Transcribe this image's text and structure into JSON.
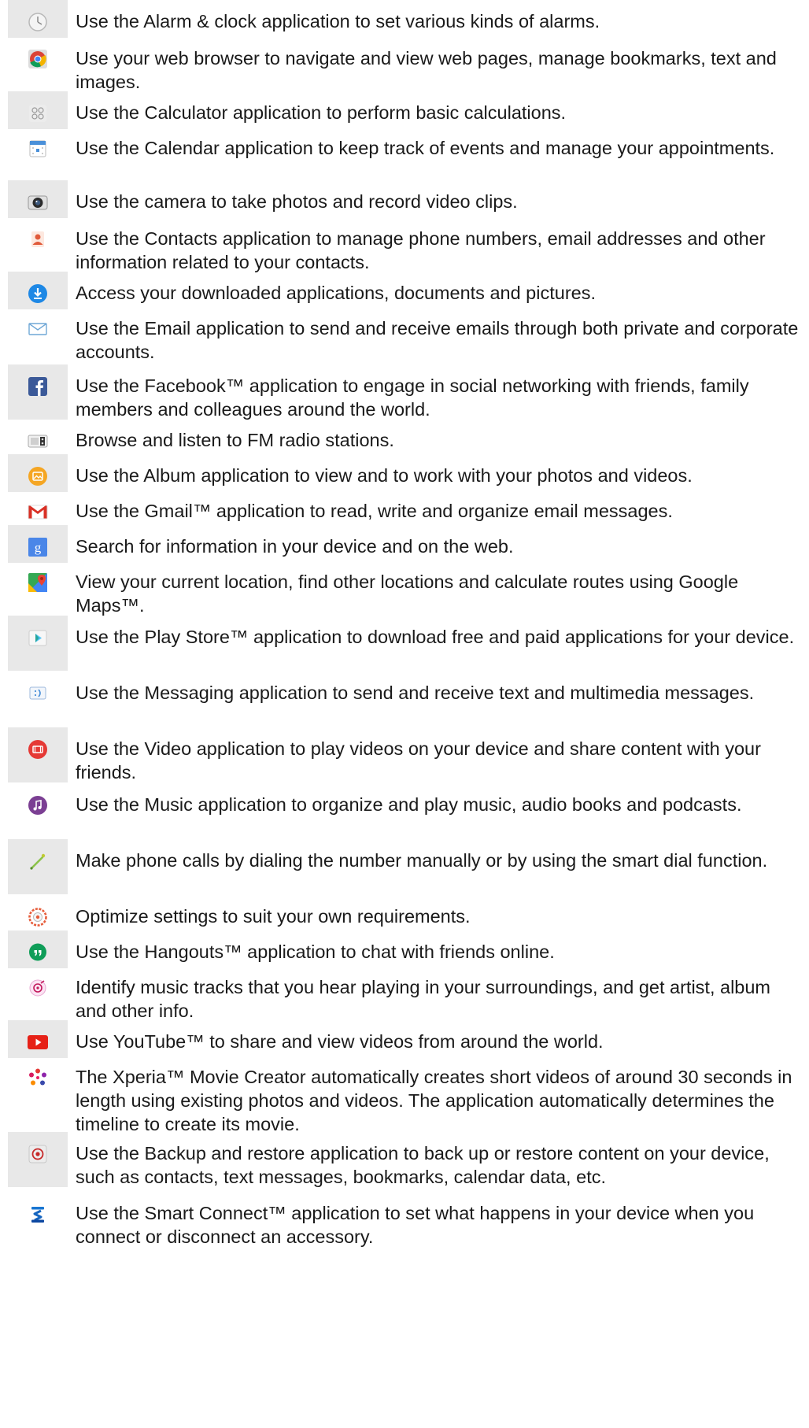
{
  "apps": [
    {
      "icon": "alarm-clock-icon",
      "text": "Use the Alarm & clock application to set various kinds of alarms."
    },
    {
      "icon": "chrome-browser-icon",
      "text": "Use your web browser to navigate and view web pages, manage bookmarks, text and images."
    },
    {
      "icon": "calculator-icon",
      "text": "Use the Calculator application to perform basic calculations."
    },
    {
      "icon": "calendar-icon",
      "text": "Use the Calendar application to keep track of events and manage your appointments."
    },
    {
      "icon": "camera-icon",
      "text": "Use the camera to take photos and record video clips."
    },
    {
      "icon": "contacts-icon",
      "text": "Use the Contacts application to manage phone numbers, email addresses and other information related to your contacts."
    },
    {
      "icon": "downloads-icon",
      "text": "Access your downloaded applications, documents and pictures."
    },
    {
      "icon": "email-icon",
      "text": "Use the Email application to send and receive emails through both private and corporate accounts."
    },
    {
      "icon": "facebook-icon",
      "text": "Use the Facebook™ application to engage in social networking with friends, family members and colleagues around the world."
    },
    {
      "icon": "fm-radio-icon",
      "text": "Browse and listen to FM radio stations."
    },
    {
      "icon": "album-icon",
      "text": "Use the Album application to view and to work with your photos and videos."
    },
    {
      "icon": "gmail-icon",
      "text": "Use the Gmail™ application to read, write and organize email messages."
    },
    {
      "icon": "google-search-icon",
      "text": "Search for information in your device and on the web."
    },
    {
      "icon": "google-maps-icon",
      "text": "View your current location, find other locations and calculate routes using Google Maps™."
    },
    {
      "icon": "play-store-icon",
      "text": "Use the Play Store™ application to download free and paid applications for your device."
    },
    {
      "icon": "messaging-icon",
      "text": "Use the Messaging application to send and receive text and multimedia messages."
    },
    {
      "icon": "video-icon",
      "text": "Use the Video application to play videos on your device and share content with your friends."
    },
    {
      "icon": "music-icon",
      "text": "Use the Music application to organize and play music, audio books and podcasts."
    },
    {
      "icon": "phone-icon",
      "text": "Make phone calls by dialing the number manually or by using the smart dial function."
    },
    {
      "icon": "settings-icon",
      "text": "Optimize settings to suit your own requirements."
    },
    {
      "icon": "hangouts-icon",
      "text": "Use the Hangouts™ application to chat with friends online."
    },
    {
      "icon": "track-id-icon",
      "text": "Identify music tracks that you hear playing in your surroundings, and get artist, album and other info."
    },
    {
      "icon": "youtube-icon",
      "text": "Use YouTube™ to share and view videos from around the world."
    },
    {
      "icon": "movie-creator-icon",
      "text": "The Xperia™ Movie Creator automatically creates short videos of around 30 seconds in length using existing photos and videos. The application automatically determines the timeline to create its movie."
    },
    {
      "icon": "backup-restore-icon",
      "text": "Use the Backup and restore application to back up or restore content on your device, such as contacts, text messages, bookmarks, calendar data, etc."
    },
    {
      "icon": "smart-connect-icon",
      "text": "Use the Smart Connect™ application to set what happens in your device when you connect or disconnect an accessory."
    }
  ]
}
